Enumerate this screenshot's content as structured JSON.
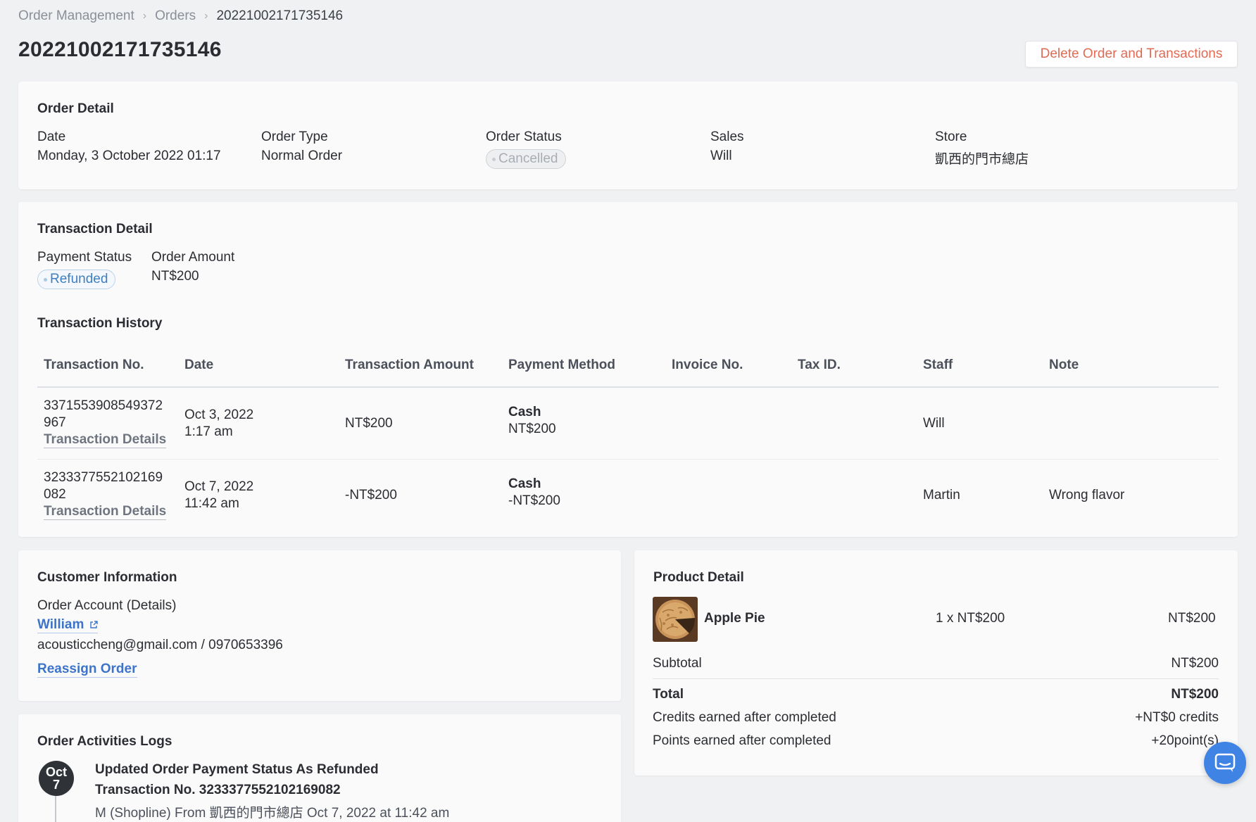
{
  "breadcrumb": {
    "items": [
      "Order Management",
      "Orders",
      "20221002171735146"
    ]
  },
  "page": {
    "title": "20221002171735146",
    "delete_button": "Delete Order and Transactions"
  },
  "order_detail": {
    "title": "Order Detail",
    "date_label": "Date",
    "date_value": "Monday, 3 October 2022 01:17",
    "type_label": "Order Type",
    "type_value": "Normal Order",
    "status_label": "Order Status",
    "status_value": "Cancelled",
    "sales_label": "Sales",
    "sales_value": "Will",
    "store_label": "Store",
    "store_value": "凱西的門市總店"
  },
  "transaction_detail": {
    "title": "Transaction Detail",
    "payment_status_label": "Payment Status",
    "payment_status_value": "Refunded",
    "order_amount_label": "Order Amount",
    "order_amount_value": "NT$200",
    "history_title": "Transaction History",
    "columns": [
      "Transaction No.",
      "Date",
      "Transaction Amount",
      "Payment Method",
      "Invoice No.",
      "Tax ID.",
      "Staff",
      "Note"
    ],
    "rows": [
      {
        "no_line1": "3371553908549372",
        "no_line2": "967",
        "details_link": "Transaction Details",
        "date_line1": "Oct 3, 2022",
        "date_line2": "1:17 am",
        "amount": "NT$200",
        "method": "Cash",
        "method_amount": "NT$200",
        "invoice": "",
        "tax_id": "",
        "staff": "Will",
        "note": ""
      },
      {
        "no_line1": "3233377552102169",
        "no_line2": "082",
        "details_link": "Transaction Details",
        "date_line1": "Oct 7, 2022",
        "date_line2": "11:42 am",
        "amount": "-NT$200",
        "method": "Cash",
        "method_amount": "-NT$200",
        "invoice": "",
        "tax_id": "",
        "staff": "Martin",
        "note": "Wrong flavor"
      }
    ]
  },
  "customer": {
    "title": "Customer Information",
    "account_label": "Order Account (Details)",
    "name": "William",
    "contact": "acousticcheng@gmail.com / 0970653396",
    "reassign": "Reassign Order"
  },
  "product": {
    "title": "Product Detail",
    "item_name": "Apple Pie",
    "item_qty_price": "1 x NT$200",
    "item_total": "NT$200",
    "subtotal_label": "Subtotal",
    "subtotal_value": "NT$200",
    "total_label": "Total",
    "total_value": "NT$200",
    "credits_label": "Credits earned after completed",
    "credits_value": "+NT$0 credits",
    "points_label": "Points earned after completed",
    "points_value": "+20point(s)"
  },
  "logs": {
    "title": "Order Activities Logs",
    "badge_month": "Oct",
    "badge_day": "7",
    "entry_title": "Updated Order Payment Status As Refunded",
    "entry_tx": "Transaction No. 3233377552102169082",
    "entry_meta": "M (Shopline) From 凱西的門市總店 Oct 7, 2022 at 11:42 am"
  },
  "colors": {
    "danger": "#e06b55",
    "link": "#3d74c9",
    "chat": "#3f84e5"
  },
  "icons": [
    "chevron-right-icon",
    "external-link-icon",
    "chat-icon"
  ]
}
